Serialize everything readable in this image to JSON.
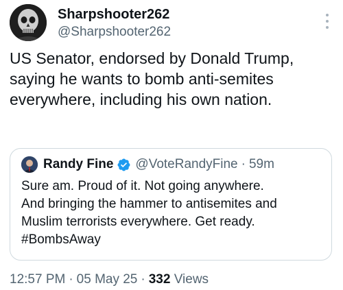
{
  "author": {
    "display_name": "Sharpshooter262",
    "handle": "@Sharpshooter262",
    "avatar_icon": "skull-portrait-avatar"
  },
  "tweet": {
    "text": "US Senator, endorsed by Donald Trump, saying he wants to bomb anti-semites everywhere, including his own nation."
  },
  "quoted_tweet": {
    "display_name": "Randy Fine",
    "verified_icon": "verified-badge-icon",
    "verified_color": "#1d9bf0",
    "handle": "@VoteRandyFine",
    "separator": "·",
    "time_ago": "59m",
    "lines": [
      "Sure am.  Proud of it.  Not going anywhere.",
      "And bringing the hammer to antisemites and",
      "Muslim terrorists everywhere.  Get ready.",
      "#BombsAway"
    ]
  },
  "meta": {
    "time": "12:57 PM",
    "separator": "·",
    "date": "05 May 25",
    "views_count": "332",
    "views_label": "Views"
  },
  "colors": {
    "text_primary": "#0f1419",
    "text_secondary": "#536471",
    "border": "#cfd9de",
    "accent": "#1d9bf0"
  }
}
